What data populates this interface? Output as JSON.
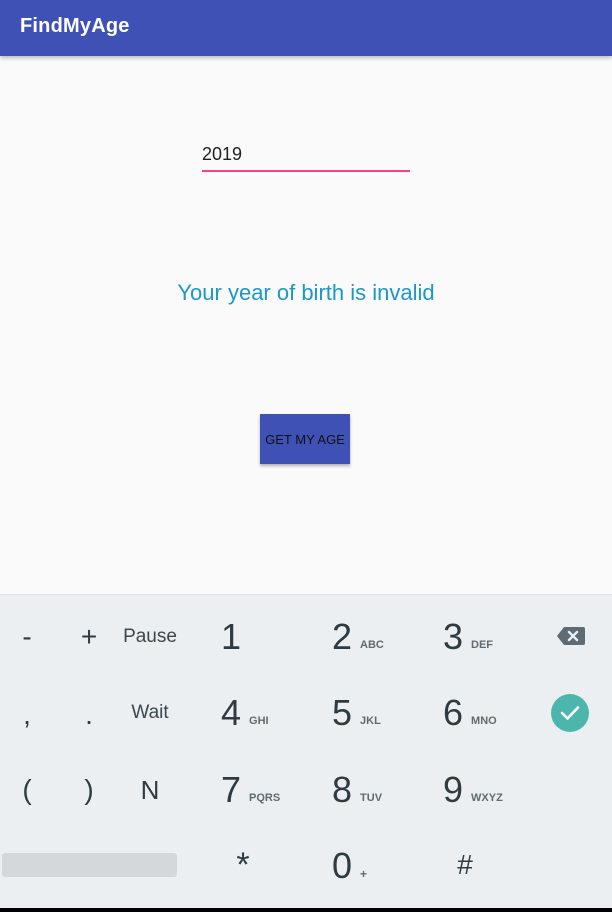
{
  "app": {
    "title": "FindMyAge"
  },
  "form": {
    "year_value": "2019",
    "message": "Your year of birth is invalid",
    "button_label": "GET MY AGE"
  },
  "keyboard": {
    "row1": {
      "minus": "-",
      "plus": "+",
      "pause": "Pause",
      "d1": "1",
      "d2": "2",
      "d2_letters": "ABC",
      "d3": "3",
      "d3_letters": "DEF"
    },
    "row2": {
      "comma": ",",
      "period": ".",
      "wait": "Wait",
      "d4": "4",
      "d4_letters": "GHI",
      "d5": "5",
      "d5_letters": "JKL",
      "d6": "6",
      "d6_letters": "MNO"
    },
    "row3": {
      "lparen": "(",
      "rparen": ")",
      "n": "N",
      "d7": "7",
      "d7_letters": "PQRS",
      "d8": "8",
      "d8_letters": "TUV",
      "d9": "9",
      "d9_letters": "WXYZ"
    },
    "row4": {
      "star": "*",
      "d0": "0",
      "d0_sub": "+",
      "hash": "#"
    },
    "icons": {
      "backspace": "backspace-icon",
      "done": "check-icon"
    }
  },
  "colors": {
    "app_bar": "#3f51b5",
    "accent": "#ff4081",
    "message_text": "#1c98c7",
    "keyboard_bg": "#eceff1",
    "done_key": "#4db6ac"
  }
}
